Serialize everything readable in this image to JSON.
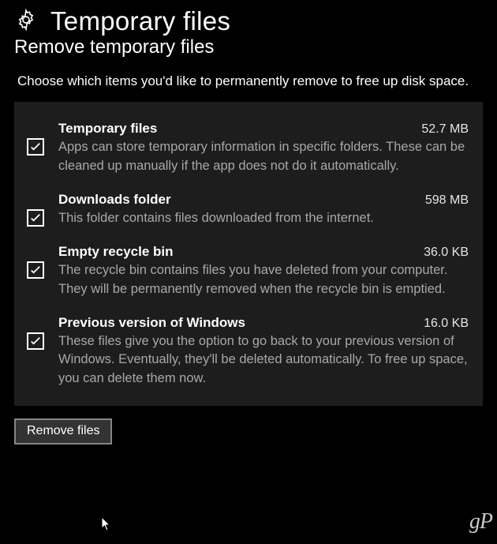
{
  "header": {
    "title": "Temporary files",
    "subtitle": "Remove temporary files",
    "instruction": "Choose which items you'd like to permanently remove to free up disk space."
  },
  "items": [
    {
      "title": "Temporary files",
      "size": "52.7 MB",
      "description": "Apps can store temporary information in specific folders. These can be cleaned up manually if the app does not do it automatically.",
      "checked": true
    },
    {
      "title": "Downloads folder",
      "size": "598 MB",
      "description": "This folder contains files downloaded from the internet.",
      "checked": true
    },
    {
      "title": "Empty recycle bin",
      "size": "36.0 KB",
      "description": "The recycle bin contains files you have deleted from your computer. They will be permanently removed when the recycle bin is emptied.",
      "checked": true
    },
    {
      "title": "Previous version of Windows",
      "size": "16.0 KB",
      "description": "These files give you the option to go back to your previous version of Windows. Eventually, they'll be deleted automatically. To free up space, you can delete them now.",
      "checked": true
    }
  ],
  "actions": {
    "remove_label": "Remove files"
  },
  "watermark": "gP"
}
